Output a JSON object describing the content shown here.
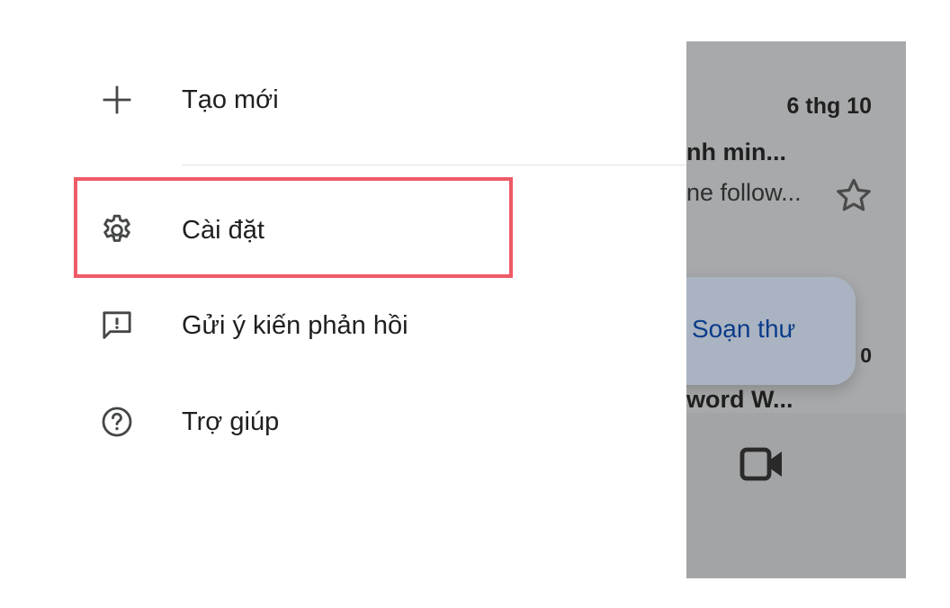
{
  "drawer": {
    "items": [
      {
        "label": "Tạo mới",
        "icon": "plus-icon"
      },
      {
        "label": "Cài đặt",
        "icon": "gear-icon"
      },
      {
        "label": "Gửi ý kiến phản hồi",
        "icon": "feedback-icon"
      },
      {
        "label": "Trợ giúp",
        "icon": "help-icon"
      }
    ],
    "highlight_color": "#ee5a66"
  },
  "background": {
    "date": "6 thg 10",
    "subject": "nh min...",
    "snippet": "ne follow...",
    "compose_label": "Soạn thư",
    "count": "0",
    "subject2": "word W...",
    "icons": [
      "star-icon",
      "video-icon"
    ]
  }
}
